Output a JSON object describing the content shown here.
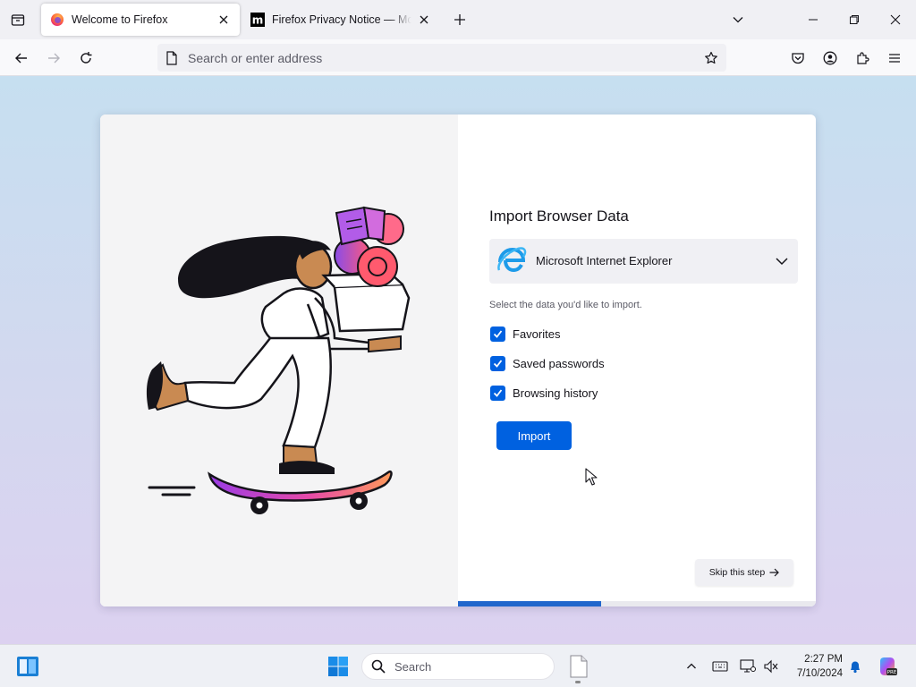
{
  "tabs": [
    {
      "title": "Welcome to Firefox",
      "active": true,
      "icon": "firefox-icon"
    },
    {
      "title": "Firefox Privacy Notice — Mozilla",
      "active": false,
      "icon": "mozilla-m-icon"
    }
  ],
  "urlbar": {
    "placeholder": "Search or enter address"
  },
  "import": {
    "title": "Import Browser Data",
    "selected_browser": "Microsoft Internet Explorer",
    "hint": "Select the data you'd like to import.",
    "options": [
      {
        "label": "Favorites",
        "checked": true
      },
      {
        "label": "Saved passwords",
        "checked": true
      },
      {
        "label": "Browsing history",
        "checked": true
      }
    ],
    "import_label": "Import",
    "skip_label": "Skip this step",
    "progress": 0.4
  },
  "colors": {
    "accent": "#0061e0",
    "progress": "#2066cc"
  },
  "taskbar": {
    "search_label": "Search",
    "time": "2:27 PM",
    "date": "7/10/2024"
  }
}
